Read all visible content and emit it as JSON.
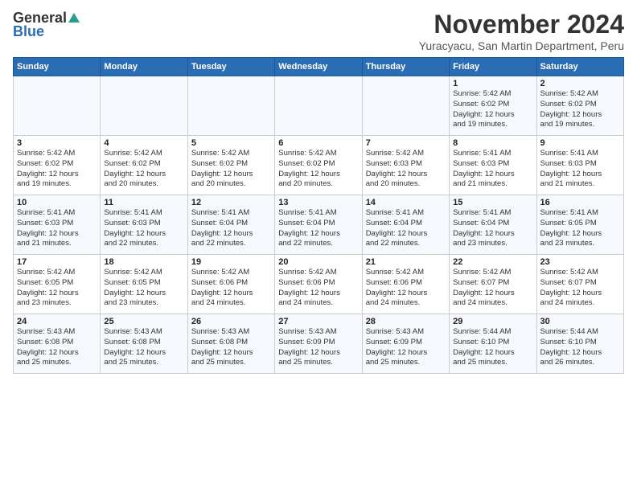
{
  "header": {
    "logo_general": "General",
    "logo_blue": "Blue",
    "month_title": "November 2024",
    "subtitle": "Yuracyacu, San Martin Department, Peru"
  },
  "days_of_week": [
    "Sunday",
    "Monday",
    "Tuesday",
    "Wednesday",
    "Thursday",
    "Friday",
    "Saturday"
  ],
  "weeks": [
    [
      {
        "day": "",
        "info": ""
      },
      {
        "day": "",
        "info": ""
      },
      {
        "day": "",
        "info": ""
      },
      {
        "day": "",
        "info": ""
      },
      {
        "day": "",
        "info": ""
      },
      {
        "day": "1",
        "info": "Sunrise: 5:42 AM\nSunset: 6:02 PM\nDaylight: 12 hours\nand 19 minutes."
      },
      {
        "day": "2",
        "info": "Sunrise: 5:42 AM\nSunset: 6:02 PM\nDaylight: 12 hours\nand 19 minutes."
      }
    ],
    [
      {
        "day": "3",
        "info": "Sunrise: 5:42 AM\nSunset: 6:02 PM\nDaylight: 12 hours\nand 19 minutes."
      },
      {
        "day": "4",
        "info": "Sunrise: 5:42 AM\nSunset: 6:02 PM\nDaylight: 12 hours\nand 20 minutes."
      },
      {
        "day": "5",
        "info": "Sunrise: 5:42 AM\nSunset: 6:02 PM\nDaylight: 12 hours\nand 20 minutes."
      },
      {
        "day": "6",
        "info": "Sunrise: 5:42 AM\nSunset: 6:02 PM\nDaylight: 12 hours\nand 20 minutes."
      },
      {
        "day": "7",
        "info": "Sunrise: 5:42 AM\nSunset: 6:03 PM\nDaylight: 12 hours\nand 20 minutes."
      },
      {
        "day": "8",
        "info": "Sunrise: 5:41 AM\nSunset: 6:03 PM\nDaylight: 12 hours\nand 21 minutes."
      },
      {
        "day": "9",
        "info": "Sunrise: 5:41 AM\nSunset: 6:03 PM\nDaylight: 12 hours\nand 21 minutes."
      }
    ],
    [
      {
        "day": "10",
        "info": "Sunrise: 5:41 AM\nSunset: 6:03 PM\nDaylight: 12 hours\nand 21 minutes."
      },
      {
        "day": "11",
        "info": "Sunrise: 5:41 AM\nSunset: 6:03 PM\nDaylight: 12 hours\nand 22 minutes."
      },
      {
        "day": "12",
        "info": "Sunrise: 5:41 AM\nSunset: 6:04 PM\nDaylight: 12 hours\nand 22 minutes."
      },
      {
        "day": "13",
        "info": "Sunrise: 5:41 AM\nSunset: 6:04 PM\nDaylight: 12 hours\nand 22 minutes."
      },
      {
        "day": "14",
        "info": "Sunrise: 5:41 AM\nSunset: 6:04 PM\nDaylight: 12 hours\nand 22 minutes."
      },
      {
        "day": "15",
        "info": "Sunrise: 5:41 AM\nSunset: 6:04 PM\nDaylight: 12 hours\nand 23 minutes."
      },
      {
        "day": "16",
        "info": "Sunrise: 5:41 AM\nSunset: 6:05 PM\nDaylight: 12 hours\nand 23 minutes."
      }
    ],
    [
      {
        "day": "17",
        "info": "Sunrise: 5:42 AM\nSunset: 6:05 PM\nDaylight: 12 hours\nand 23 minutes."
      },
      {
        "day": "18",
        "info": "Sunrise: 5:42 AM\nSunset: 6:05 PM\nDaylight: 12 hours\nand 23 minutes."
      },
      {
        "day": "19",
        "info": "Sunrise: 5:42 AM\nSunset: 6:06 PM\nDaylight: 12 hours\nand 24 minutes."
      },
      {
        "day": "20",
        "info": "Sunrise: 5:42 AM\nSunset: 6:06 PM\nDaylight: 12 hours\nand 24 minutes."
      },
      {
        "day": "21",
        "info": "Sunrise: 5:42 AM\nSunset: 6:06 PM\nDaylight: 12 hours\nand 24 minutes."
      },
      {
        "day": "22",
        "info": "Sunrise: 5:42 AM\nSunset: 6:07 PM\nDaylight: 12 hours\nand 24 minutes."
      },
      {
        "day": "23",
        "info": "Sunrise: 5:42 AM\nSunset: 6:07 PM\nDaylight: 12 hours\nand 24 minutes."
      }
    ],
    [
      {
        "day": "24",
        "info": "Sunrise: 5:43 AM\nSunset: 6:08 PM\nDaylight: 12 hours\nand 25 minutes."
      },
      {
        "day": "25",
        "info": "Sunrise: 5:43 AM\nSunset: 6:08 PM\nDaylight: 12 hours\nand 25 minutes."
      },
      {
        "day": "26",
        "info": "Sunrise: 5:43 AM\nSunset: 6:08 PM\nDaylight: 12 hours\nand 25 minutes."
      },
      {
        "day": "27",
        "info": "Sunrise: 5:43 AM\nSunset: 6:09 PM\nDaylight: 12 hours\nand 25 minutes."
      },
      {
        "day": "28",
        "info": "Sunrise: 5:43 AM\nSunset: 6:09 PM\nDaylight: 12 hours\nand 25 minutes."
      },
      {
        "day": "29",
        "info": "Sunrise: 5:44 AM\nSunset: 6:10 PM\nDaylight: 12 hours\nand 25 minutes."
      },
      {
        "day": "30",
        "info": "Sunrise: 5:44 AM\nSunset: 6:10 PM\nDaylight: 12 hours\nand 26 minutes."
      }
    ]
  ]
}
